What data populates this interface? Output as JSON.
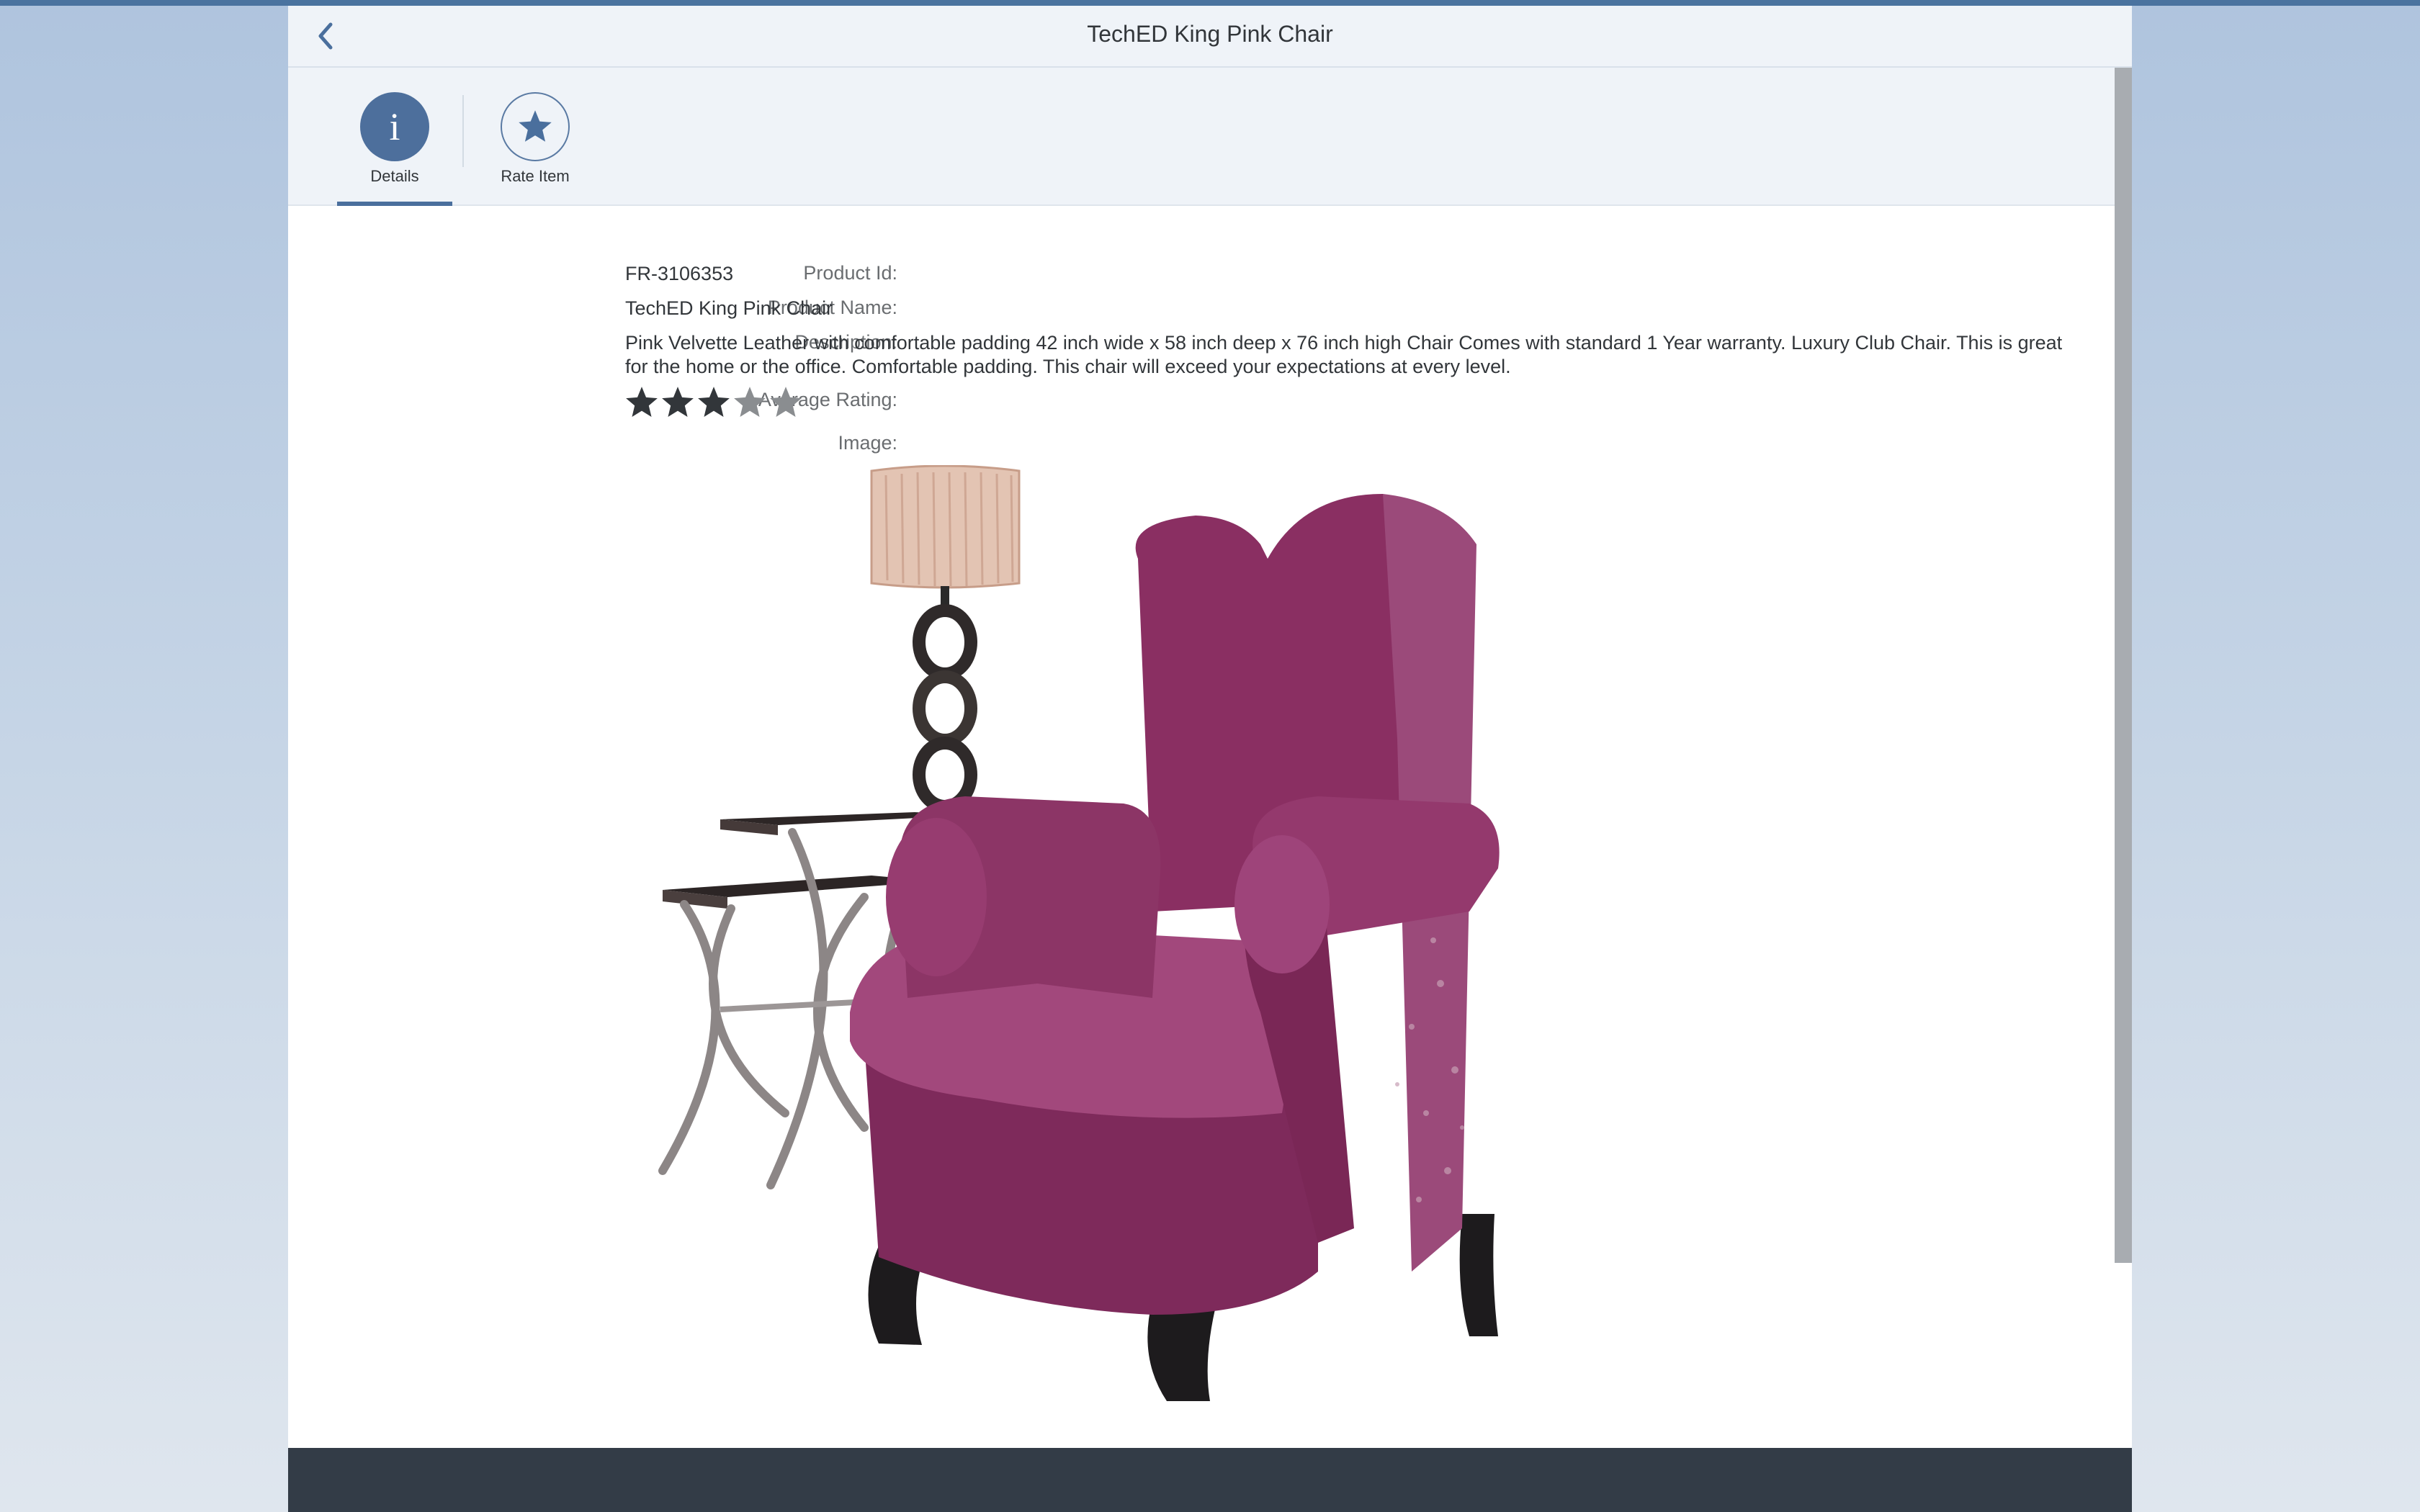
{
  "header": {
    "title": "TechED King Pink Chair",
    "back_icon": "chevron-left-icon"
  },
  "tabs": [
    {
      "label": "Details",
      "icon": "info-icon",
      "selected": true
    },
    {
      "label": "Rate Item",
      "icon": "star-icon",
      "selected": false
    }
  ],
  "details": {
    "product_id_label": "Product Id:",
    "product_id": "FR-3106353",
    "product_name_label": "Product Name:",
    "product_name": "TechED King Pink Chair",
    "description_label": "Description:",
    "description": "Pink Velvette Leather with comfortable padding 42 inch wide x 58 inch deep x 76 inch high Chair Comes with standard 1 Year warranty. Luxury Club Chair. This is great for the home or the office. Comfortable padding. This chair will exceed your expectations at every level.",
    "rating_label": "Average Rating:",
    "rating_value": 3,
    "rating_max": 5,
    "image_label": "Image:"
  },
  "colors": {
    "accent": "#4a6f9d",
    "star_filled": "#32363a",
    "star_empty": "#8a8d90",
    "footer": "#333c47"
  }
}
